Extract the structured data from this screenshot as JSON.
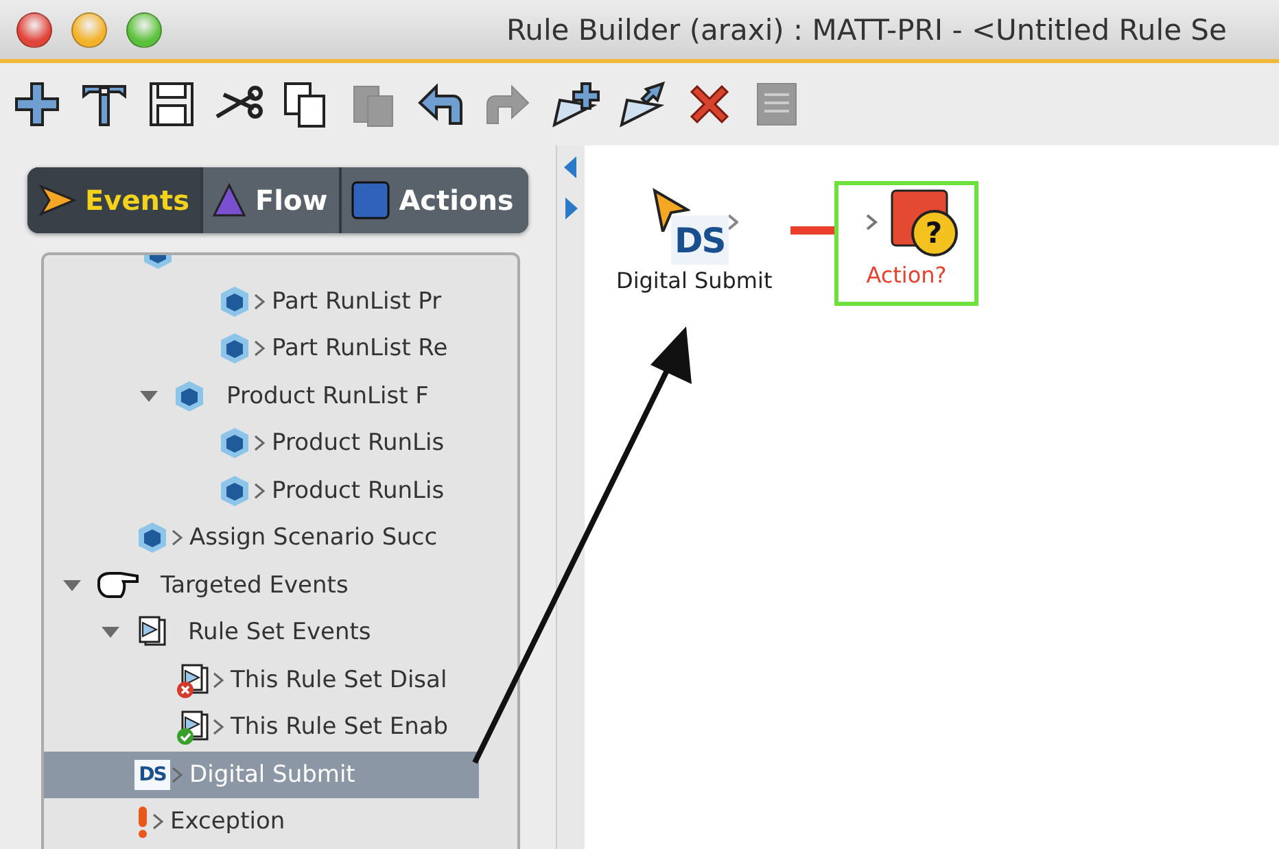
{
  "window": {
    "title": "Rule Builder (araxi) : MATT-PRI - <Untitled Rule Se"
  },
  "toolbar": [
    {
      "kind": "add",
      "disabled": false
    },
    {
      "kind": "hammer",
      "disabled": false
    },
    {
      "kind": "save",
      "disabled": false
    },
    {
      "kind": "cut",
      "disabled": false
    },
    {
      "kind": "copy",
      "disabled": false
    },
    {
      "kind": "paste",
      "disabled": true
    },
    {
      "kind": "undo",
      "disabled": false
    },
    {
      "kind": "redo",
      "disabled": true
    },
    {
      "kind": "add-event",
      "disabled": false
    },
    {
      "kind": "insert-event",
      "disabled": false
    },
    {
      "kind": "delete",
      "disabled": false
    },
    {
      "kind": "list",
      "disabled": true
    }
  ],
  "tabs": [
    {
      "label": "Events",
      "kind": "events",
      "selected": true
    },
    {
      "label": "Flow",
      "kind": "flow",
      "selected": false
    },
    {
      "label": "Actions",
      "kind": "actions",
      "selected": false
    }
  ],
  "tree": [
    {
      "children": [
        {
          "children": [
            {
              "kind": "event",
              "children": [
                {
                  "label": "Part RunList Pr",
                  "kind": "event",
                  "selected": false
                },
                {
                  "label": "Part RunList Re",
                  "kind": "event",
                  "selected": false
                }
              ]
            },
            {
              "label": "Product RunList F",
              "kind": "event",
              "expanded": true,
              "selected": false,
              "children": [
                {
                  "label": "Product RunLis",
                  "kind": "event",
                  "selected": false
                },
                {
                  "label": "Product RunLis",
                  "kind": "event",
                  "selected": false
                }
              ]
            }
          ]
        },
        {
          "label": "Assign Scenario Succ",
          "kind": "event",
          "selected": false
        }
      ]
    },
    {
      "label": "Targeted Events",
      "kind": "hand",
      "expanded": true,
      "selected": false,
      "children": [
        {
          "label": "Rule Set Events",
          "kind": "ruleset",
          "expanded": true,
          "selected": false,
          "children": [
            {
              "label": "This Rule Set Disal",
              "kind": "ruleset-disabled",
              "selected": false
            },
            {
              "label": "This Rule Set Enab",
              "kind": "ruleset-enabled",
              "selected": false
            }
          ]
        },
        {
          "label": "Digital Submit",
          "kind": "ds",
          "badge": "DS",
          "selected": true
        },
        {
          "label": "Exception",
          "kind": "exception",
          "selected": false
        }
      ]
    }
  ],
  "canvas": {
    "nodes": [
      {
        "label": "Digital Submit",
        "kind": "event",
        "badge": "DS",
        "selected": false
      },
      {
        "label": "Action?",
        "kind": "action",
        "badge": "?",
        "selected": true
      }
    ]
  }
}
